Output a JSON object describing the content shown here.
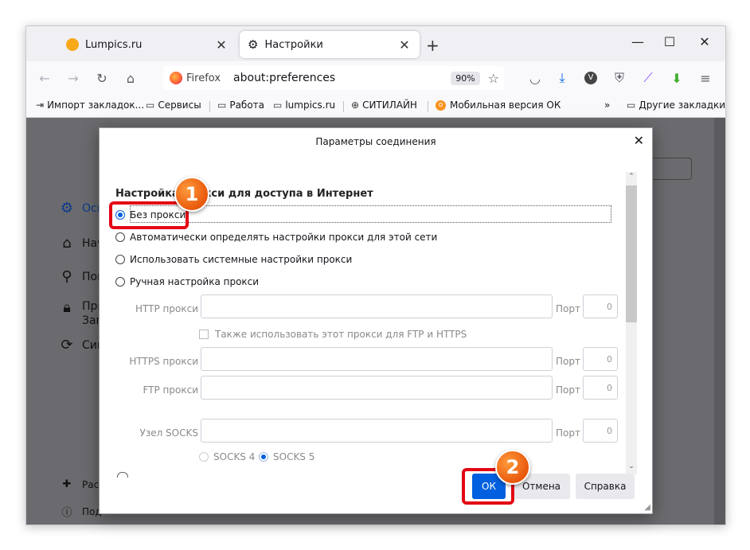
{
  "tabs": [
    {
      "label": "Lumpics.ru",
      "icon": "lumpics-icon"
    },
    {
      "label": "Настройки",
      "icon": "gear-icon"
    }
  ],
  "nav": {
    "identity": "Firefox",
    "url": "about:preferences",
    "zoom": "90%"
  },
  "bookmarks": [
    {
      "label": "Импорт закладок...",
      "icon": "import-icon"
    },
    {
      "label": "Сервисы",
      "icon": "folder-icon"
    },
    {
      "label": "Работа",
      "icon": "folder-icon"
    },
    {
      "label": "lumpics.ru",
      "icon": "folder-icon"
    },
    {
      "label": "СИТИЛАЙН",
      "icon": "globe-icon"
    },
    {
      "label": "Мобильная версия ОК",
      "icon": "ok-icon"
    },
    {
      "label": "Другие закладки",
      "icon": "folder-icon"
    }
  ],
  "sidebar": [
    "Осн",
    "Нач",
    "Пои",
    "При",
    "Зап",
    "Син",
    "Рас",
    "Под"
  ],
  "dialog": {
    "title": "Параметры соединения",
    "heading": "Настройка прокси для доступа в Интернет",
    "options": [
      "Без прокси",
      "Автоматически определять настройки прокси для этой сети",
      "Использовать системные настройки прокси",
      "Ручная настройка прокси"
    ],
    "http_label": "HTTP прокси",
    "https_label": "HTTPS прокси",
    "ftp_label": "FTP прокси",
    "socks_label": "Узел SOCKS",
    "port_label": "Порт",
    "port_value": "0",
    "also_use": "Также использовать этот прокси для FTP и HTTPS",
    "socks4": "SOCKS 4",
    "socks5": "SOCKS 5",
    "ok": "ОК",
    "cancel": "Отмена",
    "help": "Справка"
  },
  "annotations": {
    "step1": "1",
    "step2": "2"
  },
  "colors": {
    "accent": "#0060df",
    "highlight": "#e30613",
    "badge": "#e8590c"
  }
}
